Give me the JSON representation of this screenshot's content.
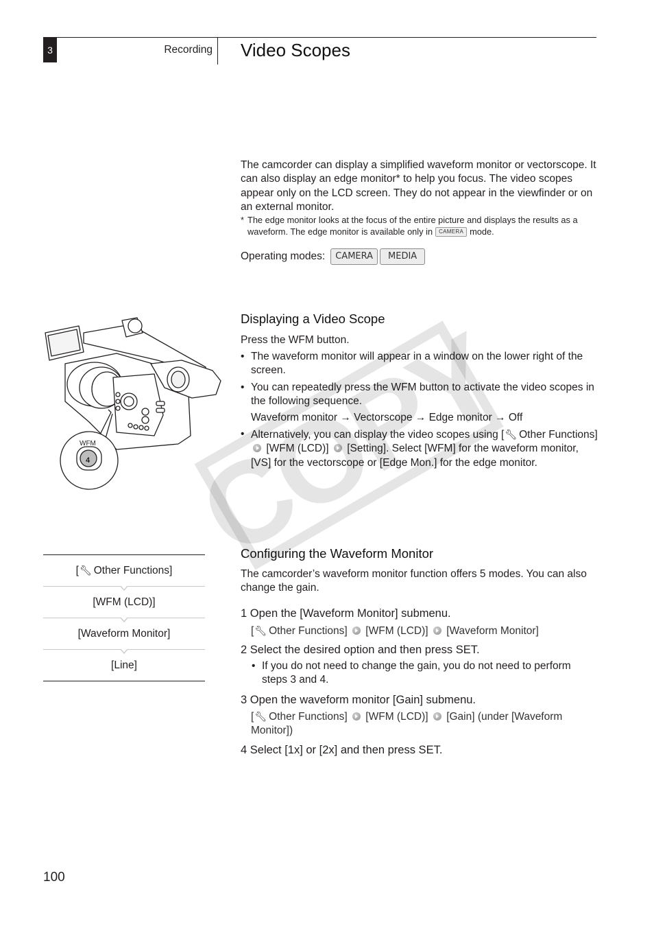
{
  "header": {
    "chapter_number": "3",
    "section": "Recording",
    "title": "Video Scopes"
  },
  "intro": {
    "paragraph": "The camcorder can display a simplified waveform monitor or vectorscope. It can also display an edge monitor* to help you focus. The video scopes appear only on the LCD screen. They do not appear in the viewfinder or on an external monitor.",
    "footnote_star": "*",
    "footnote_before": "The edge monitor looks at the focus of the entire picture and displays the results as a waveform. The edge monitor is available only in",
    "footnote_mode": "CAMERA",
    "footnote_after": "mode.",
    "operating_modes_label": "Operating modes:",
    "operating_modes": [
      "CAMERA",
      "MEDIA"
    ]
  },
  "illustration": {
    "button_label": "WFM",
    "button_number": "4"
  },
  "section_display": {
    "heading": "Displaying a Video Scope",
    "instruction": "Press the WFM button.",
    "bullets": [
      "The waveform monitor will appear in a window on the lower right of the screen.",
      "You can repeatedly press the WFM button to activate the video scopes in the following sequence."
    ],
    "sequence": "Waveform monitor → Vectorscope → Edge monitor → Off",
    "alt_bullet": {
      "part1": "Alternatively, you can display the video scopes using [",
      "part2": "Other Functions]",
      "part3": "[WFM (LCD)]",
      "part4": "[Setting]. Select [WFM] for the waveform monitor, [VS] for the vectorscope or [Edge Mon.] for the edge monitor."
    }
  },
  "menu_path": {
    "items": [
      "Other Functions]",
      "[WFM (LCD)]",
      "[Waveform Monitor]",
      "[Line]"
    ],
    "first_prefix": "["
  },
  "section_config": {
    "heading": "Configuring the Waveform Monitor",
    "intro": "The camcorder’s waveform monitor function offers 5 modes. You can also change the gain.",
    "steps": [
      {
        "label": "1 Open the [Waveform Monitor] submenu.",
        "path": [
          "[",
          "Other Functions]",
          "[WFM (LCD)]",
          "[Waveform Monitor]"
        ]
      },
      {
        "label": "2 Select the desired option and then press SET.",
        "bullet": "If you do not need to change the gain, you do not need to perform steps 3 and 4."
      },
      {
        "label": "3 Open the waveform monitor [Gain] submenu.",
        "path": [
          "[",
          "Other Functions]",
          "[WFM (LCD)]",
          "[Gain] (under [Waveform Monitor])"
        ]
      },
      {
        "label": "4 Select [1x] or [2x] and then press SET."
      }
    ]
  },
  "watermark": "COPY",
  "page_number": "100",
  "icons": {
    "wrench": "wrench-icon",
    "menu_arrow": "menu-arrow-icon",
    "bullet": "•"
  }
}
